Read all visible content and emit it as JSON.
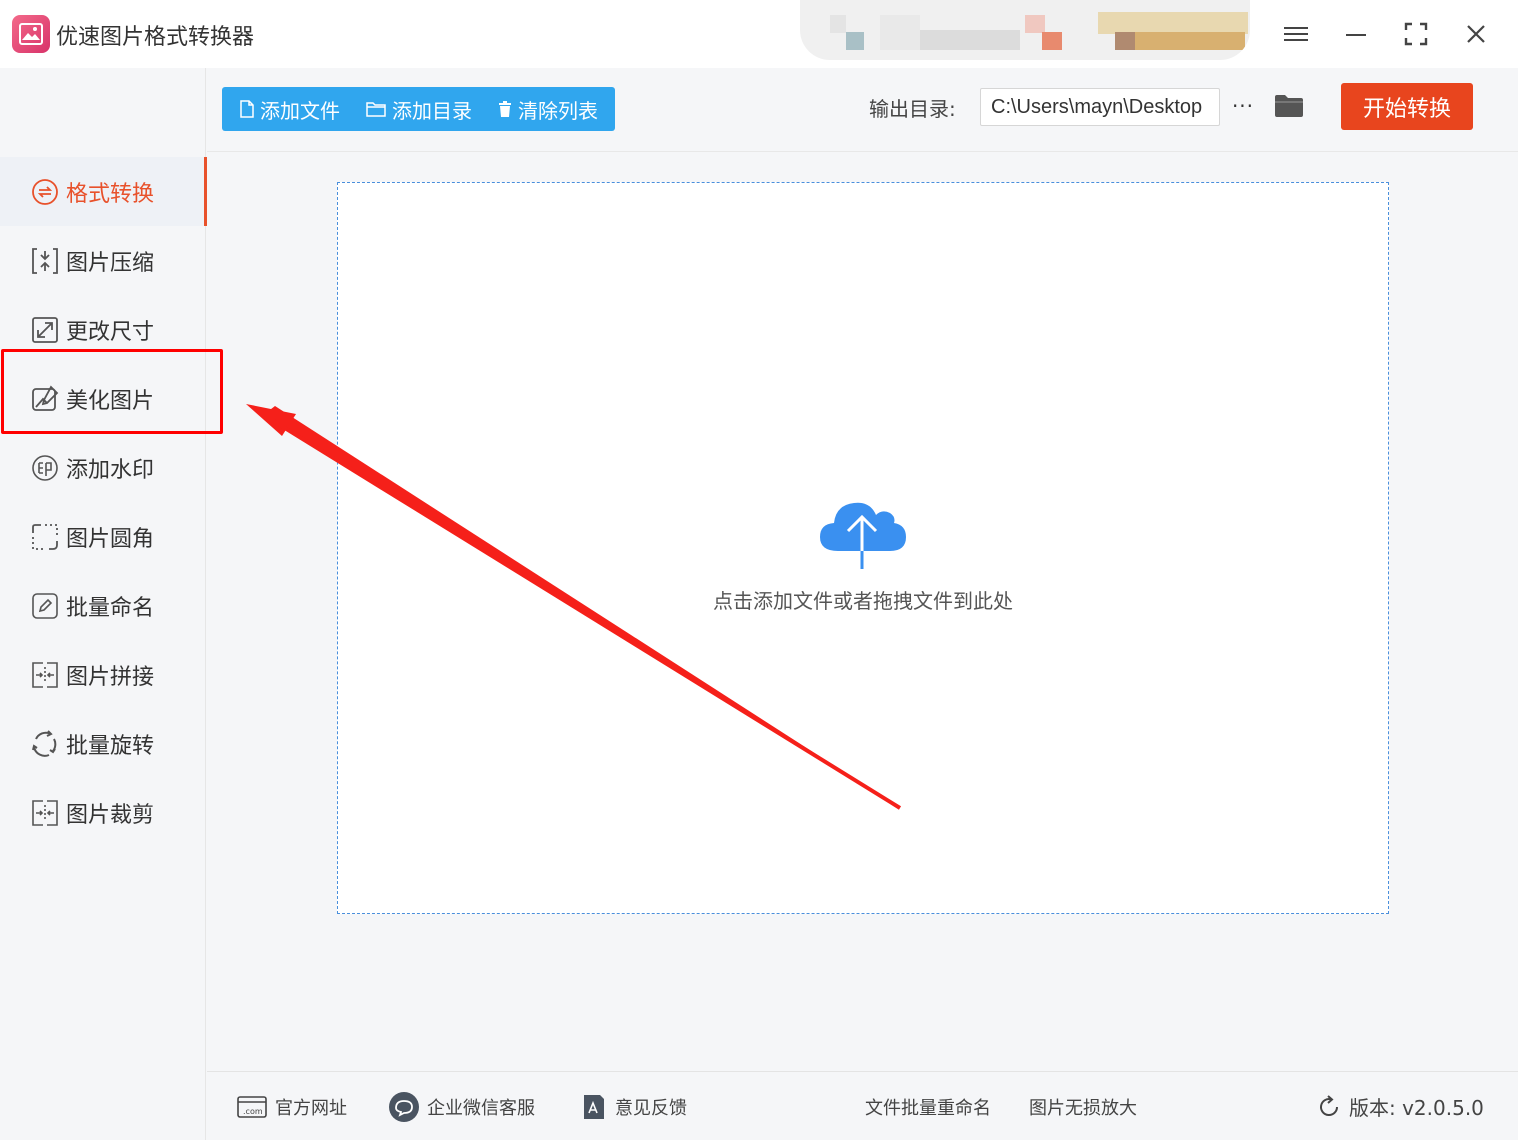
{
  "app": {
    "title": "优速图片格式转换器"
  },
  "colors": {
    "accent": "#e8512b",
    "primary_blue": "#30a6ee",
    "start": "#e8451e",
    "highlight": "#ff0000"
  },
  "sidebar": {
    "items": [
      {
        "label": "格式转换",
        "icon": "convert-icon",
        "active": true
      },
      {
        "label": "图片压缩",
        "icon": "compress-icon"
      },
      {
        "label": "更改尺寸",
        "icon": "resize-icon"
      },
      {
        "label": "美化图片",
        "icon": "beautify-icon"
      },
      {
        "label": "添加水印",
        "icon": "watermark-icon"
      },
      {
        "label": "图片圆角",
        "icon": "rounded-corner-icon"
      },
      {
        "label": "批量命名",
        "icon": "rename-icon"
      },
      {
        "label": "图片拼接",
        "icon": "stitch-icon"
      },
      {
        "label": "批量旋转",
        "icon": "rotate-icon"
      },
      {
        "label": "图片裁剪",
        "icon": "crop-icon"
      }
    ]
  },
  "toolbar": {
    "add_file": "添加文件",
    "add_folder": "添加目录",
    "clear_list": "清除列表",
    "output_label": "输出目录:",
    "output_path": "C:\\Users\\mayn\\Desktop",
    "more": "···",
    "start": "开始转换"
  },
  "dropzone": {
    "hint": "点击添加文件或者拖拽文件到此处"
  },
  "footer": {
    "website": "官方网址",
    "wechat": "企业微信客服",
    "feedback": "意见反馈",
    "batch_rename": "文件批量重命名",
    "lossless_enlarge": "图片无损放大",
    "version": "版本: v2.0.5.0"
  }
}
